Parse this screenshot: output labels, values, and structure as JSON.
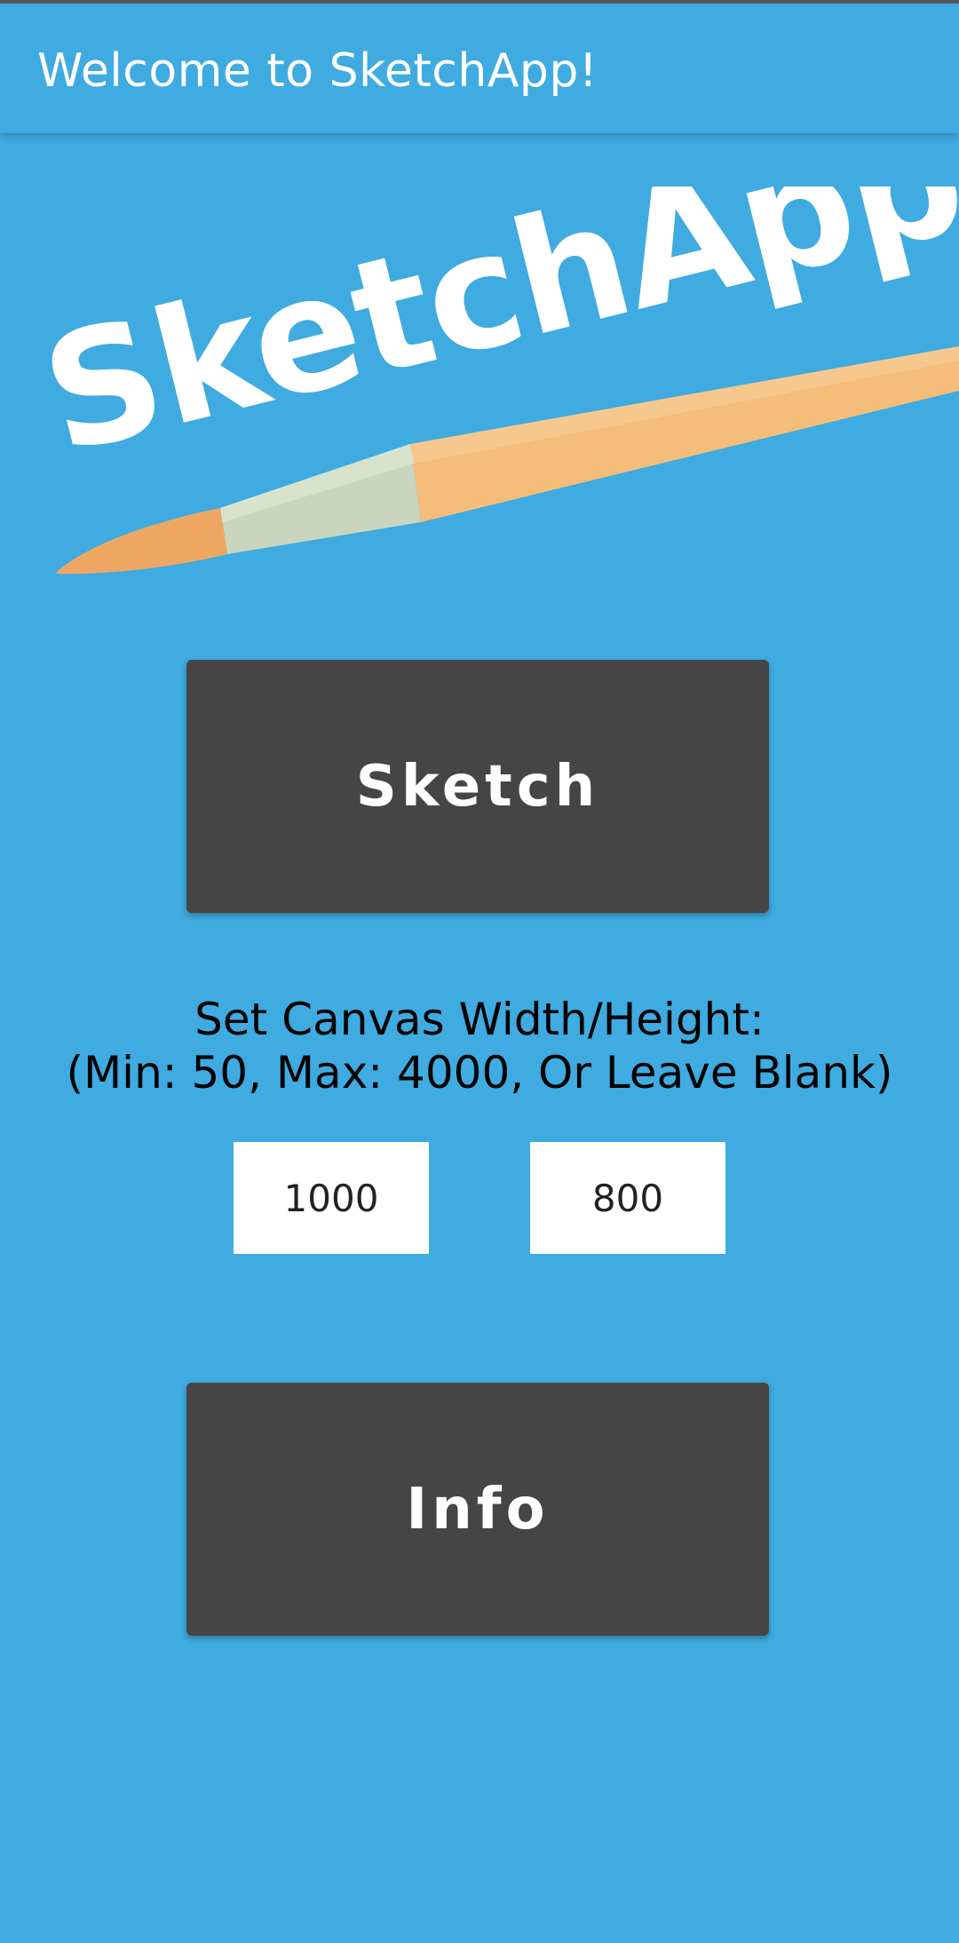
{
  "app_bar": {
    "title": "Welcome to SketchApp!"
  },
  "logo": {
    "text": "SketchApp",
    "icon": "paintbrush-icon"
  },
  "sketch_button": {
    "label": "Sketch"
  },
  "canvas_settings": {
    "line1": "Set Canvas Width/Height:",
    "line2": "(Min: 50, Max: 4000, Or Leave Blank)",
    "width_value": "1000",
    "height_value": "800"
  },
  "info_button": {
    "label": "Info"
  },
  "colors": {
    "background": "#3fabe0",
    "button": "#454545",
    "brush_handle": "#f4bd7a",
    "brush_ferrule": "#c9d6bd",
    "brush_tip": "#eea763"
  }
}
